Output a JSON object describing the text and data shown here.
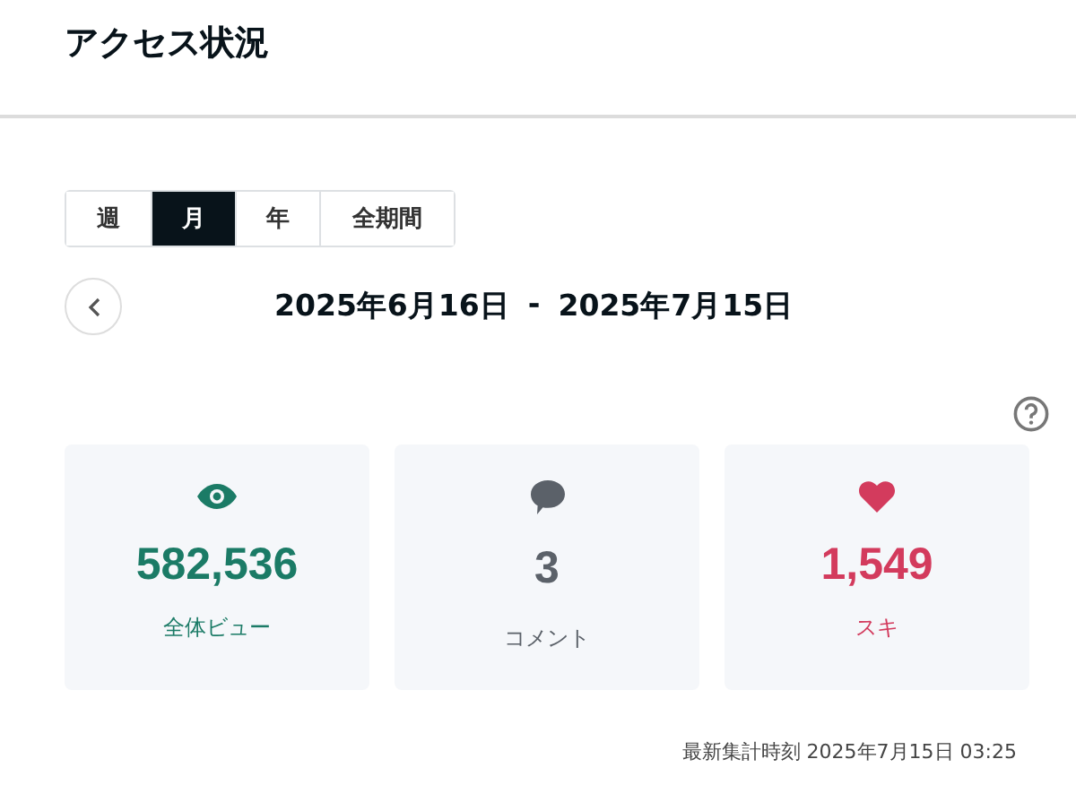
{
  "header": {
    "title": "アクセス状況"
  },
  "period_tabs": [
    {
      "label": "週",
      "selected": false
    },
    {
      "label": "月",
      "selected": true
    },
    {
      "label": "年",
      "selected": false
    },
    {
      "label": "全期間",
      "selected": false
    }
  ],
  "date_range": {
    "start": "2025年6月16日",
    "separator": "-",
    "end": "2025年7月15日"
  },
  "stats": [
    {
      "kind": "views",
      "value": "582,536",
      "label": "全体ビュー",
      "color": "#1b7b66"
    },
    {
      "kind": "comments",
      "value": "3",
      "label": "コメント",
      "color": "#5b6169"
    },
    {
      "kind": "likes",
      "value": "1,549",
      "label": "スキ",
      "color": "#d33b5d"
    }
  ],
  "footer": {
    "updated_label": "最新集計時刻 2025年7月15日 03:25"
  }
}
